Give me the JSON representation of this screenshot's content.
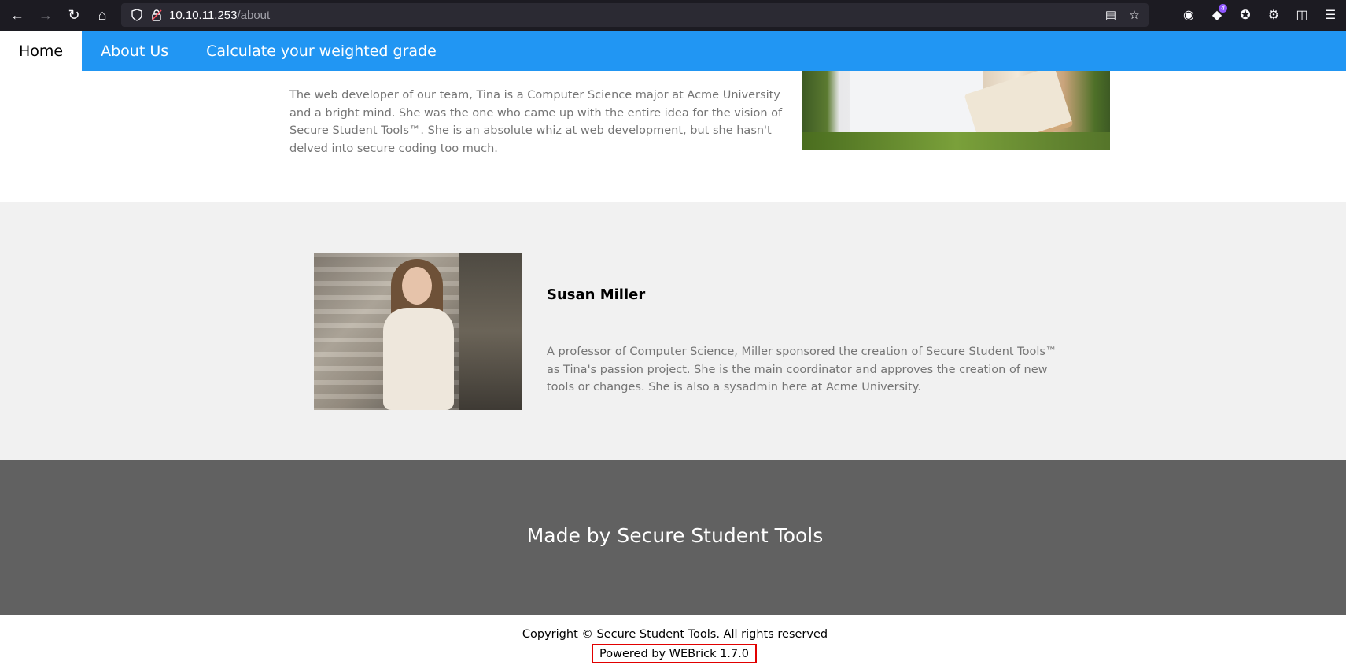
{
  "browser": {
    "url_host": "10.10.11.253",
    "url_path": "/about",
    "extension_badge": "4"
  },
  "nav": {
    "items": [
      {
        "label": "Home"
      },
      {
        "label": "About Us"
      },
      {
        "label": "Calculate your weighted grade"
      }
    ]
  },
  "tina": {
    "bio": "The web developer of our team, Tina is a Computer Science major at Acme University and a bright mind. She was the one who came up with the entire idea for the vision of Secure Student Tools™. She is an absolute whiz at web development, but she hasn't delved into secure coding too much."
  },
  "susan": {
    "name": "Susan Miller",
    "bio": "A professor of Computer Science, Miller sponsored the creation of Secure Student Tools™ as Tina's passion project. She is the main coordinator and approves the creation of new tools or changes. She is also a sysadmin here at Acme University."
  },
  "footer": {
    "title": "Made by Secure Student Tools",
    "copyright": "Copyright © Secure Student Tools. All rights reserved",
    "powered_by": "Powered by WEBrick 1.7.0"
  },
  "colors": {
    "nav_bg": "#2196f3",
    "section_alt_bg": "#f1f1f1",
    "footer_bg": "#616161",
    "highlight_border": "#e10000"
  }
}
